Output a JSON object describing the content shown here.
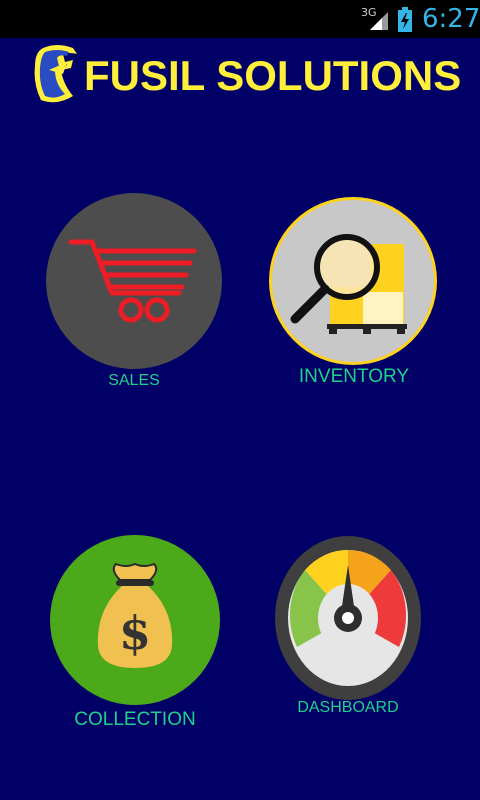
{
  "status_bar": {
    "network": "3G",
    "time": "6:27",
    "signal_icon": "signal-icon",
    "battery_icon": "battery-charging-icon"
  },
  "header": {
    "title": "FUSIL SOLUTIONS",
    "logo_icon": "fusil-logo-icon"
  },
  "menu": {
    "sales": {
      "label": "SALES",
      "icon": "shopping-cart-icon"
    },
    "inventory": {
      "label": "INVENTORY",
      "icon": "magnifier-boxes-icon"
    },
    "collection": {
      "label": "COLLECTION",
      "icon": "money-bag-icon"
    },
    "dashboard": {
      "label": "DASHBOARD",
      "icon": "gauge-icon"
    }
  },
  "colors": {
    "background": "#000066",
    "title": "#ffef3a",
    "label": "#1fd18a",
    "status_text": "#33b5e5"
  }
}
